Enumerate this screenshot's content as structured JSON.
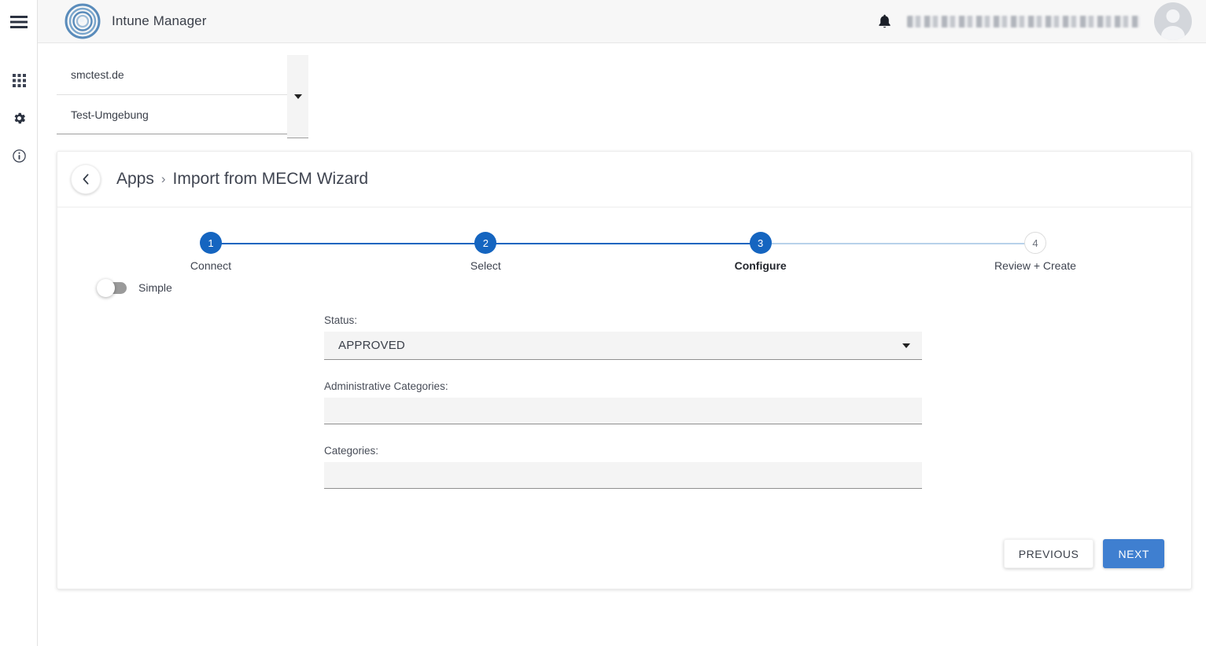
{
  "colors": {
    "accent": "#1565c0",
    "primary_button": "#3f7fd0",
    "rail_icon": "#2b3240",
    "track_done": "#1565c0",
    "track_todo": "#b8d2ea"
  },
  "rail": {
    "items": [
      {
        "icon": "hamburger-menu-icon",
        "name": "menu"
      },
      {
        "icon": "grid-apps-icon",
        "name": "apps"
      },
      {
        "icon": "gear-icon",
        "name": "settings"
      },
      {
        "icon": "info-icon",
        "name": "info"
      }
    ]
  },
  "header": {
    "logo_icon": "concentric-circles-logo",
    "title": "Intune Manager",
    "bell_icon": "notification-bell-icon",
    "user_name": "",
    "avatar_icon": "user-avatar-icon"
  },
  "tenant_selector": {
    "domain": "smctest.de",
    "environment": "Test-Umgebung",
    "caret_icon": "chevron-down-icon"
  },
  "card": {
    "back_icon": "chevron-left-icon",
    "breadcrumb": {
      "parent": "Apps",
      "separator": "›",
      "current": "Import from MECM Wizard"
    }
  },
  "stepper": {
    "active_index": 2,
    "steps": [
      {
        "number": "1",
        "label": "Connect",
        "state": "done"
      },
      {
        "number": "2",
        "label": "Select",
        "state": "done"
      },
      {
        "number": "3",
        "label": "Configure",
        "state": "active"
      },
      {
        "number": "4",
        "label": "Review + Create",
        "state": "todo"
      }
    ]
  },
  "toggle": {
    "label": "Simple",
    "checked": false
  },
  "form": {
    "fields": [
      {
        "label": "Status:",
        "value": "APPROVED",
        "type": "select",
        "placeholder": ""
      },
      {
        "label": "Administrative Categories:",
        "value": "",
        "type": "text",
        "placeholder": ""
      },
      {
        "label": "Categories:",
        "value": "",
        "type": "text",
        "placeholder": ""
      }
    ]
  },
  "actions": {
    "previous_label": "PREVIOUS",
    "next_label": "NEXT"
  }
}
